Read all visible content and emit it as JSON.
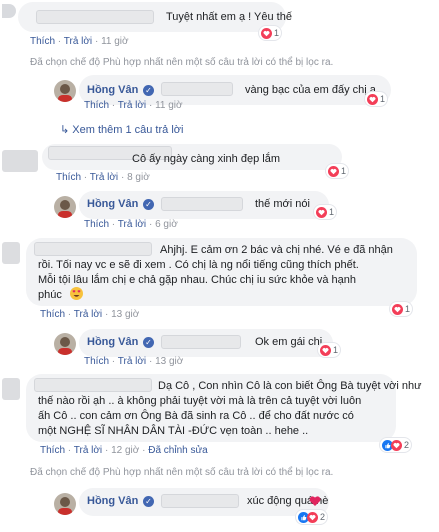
{
  "actions": {
    "like": "Thích",
    "reply": "Trả lời",
    "dot": "·"
  },
  "comments": [
    {
      "text": "Tuyệt nhất em ạ ! Yêu thế",
      "time": "11 giờ",
      "reactions": "1",
      "note": "Đã chọn chế độ Phù hợp nhất nên một số câu trả lời có thể bị lọc ra.",
      "reply": {
        "name": "Hồng Vân",
        "text": "vàng bạc của em đấy chị ạ",
        "time": "11 giờ",
        "reactions": "1"
      },
      "more": "Xem thêm 1 câu trả lời"
    },
    {
      "text": "Cô ấy ngày càng xinh đẹp lắm",
      "time": "8 giờ",
      "reactions": "1",
      "reply": {
        "name": "Hồng Vân",
        "text": "thế mới nói",
        "time": "6 giờ",
        "reactions": "1"
      }
    },
    {
      "lines": [
        "Ahjhj. E cảm ơn 2 bác và chị nhé. Vé e đã nhận",
        "rồi. Tối nay vc e sẽ đi xem . Có chị là ng nổi tiếng cũng thích phết.",
        "Mỗi tội lâu lắm chị e chả gặp nhau. Chúc chị iu sức khỏe và hạnh",
        "phúc"
      ],
      "emoji": "heart-eyes",
      "time": "13 giờ",
      "reactions": "1",
      "reply": {
        "name": "Hồng Vân",
        "text": "Ok em gái chị",
        "time": "13 giờ",
        "reactions": "1"
      }
    },
    {
      "lines": [
        "Dạ Cô , Con nhìn Cô là con biết Ông Bà tuyệt vời như",
        "thế nào rồi ạh .. à không phải tuyệt vời mà là trên cả tuyệt vời luôn",
        "ấh Cô .. con cảm ơn Ông Bà đã sinh ra Cô .. để cho đất nước có",
        "một NGHỆ SĨ NHÂN DÂN TÀI -ĐỨC vẹn toàn .. hehe .."
      ],
      "time": "12 giờ",
      "edited": "Đã chỉnh sửa",
      "reactions": "2",
      "note": "Đã chọn chế độ Phù hợp nhất nên một số câu trả lời có thể bị lọc ra.",
      "reply": {
        "name": "Hồng Vân",
        "text": "xúc động quá nè",
        "reactions": "2"
      }
    }
  ]
}
